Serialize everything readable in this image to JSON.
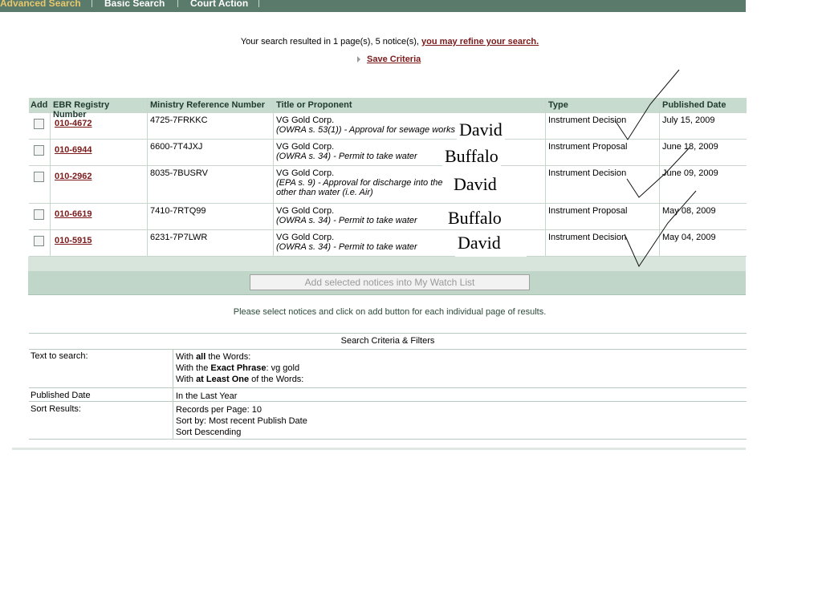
{
  "nav": {
    "items": [
      "Advanced Search",
      "Basic Search",
      "Court Action"
    ]
  },
  "results": {
    "message": "Your search resulted in 1 page(s), 5 notice(s), ",
    "refine_link": "you may refine your search.",
    "save_criteria": "Save Criteria"
  },
  "table": {
    "headers": [
      "Add",
      "EBR Registry Number",
      "Ministry Reference Number",
      "Title or Proponent",
      "Type",
      "Published Date"
    ],
    "rows": [
      {
        "registry": "010-4672",
        "ministry": "4725-7FRKKC",
        "proponent": "VG Gold Corp.",
        "act": "OWRA s. 53(1)",
        "desc": " - Approval for sewage works",
        "desc2": "",
        "type": "Instrument Decision",
        "date": "July 15, 2009",
        "hand": "David"
      },
      {
        "registry": "010-6944",
        "ministry": "6600-7T4JXJ",
        "proponent": "VG Gold Corp.",
        "act": "OWRA s. 34",
        "desc": " - Permit to take water",
        "desc2": "",
        "type": "Instrument Proposal",
        "date": "June 18, 2009",
        "hand": "Buffalo"
      },
      {
        "registry": "010-2962",
        "ministry": "8035-7BUSRV",
        "proponent": "VG Gold Corp.",
        "act": "EPA s. 9",
        "desc": " - Approval for discharge into the",
        "desc2": "other than water (i.e. Air)",
        "type": "Instrument Decision",
        "date": "June 09, 2009",
        "hand": "David"
      },
      {
        "registry": "010-6619",
        "ministry": "7410-7RTQ99",
        "proponent": "VG Gold Corp.",
        "act": "OWRA s. 34",
        "desc": " - Permit to take water",
        "desc2": "",
        "type": "Instrument Proposal",
        "date": "May 08, 2009",
        "hand": "Buffalo"
      },
      {
        "registry": "010-5915",
        "ministry": "6231-7P7LWR",
        "proponent": "VG Gold Corp.",
        "act": "OWRA s. 34",
        "desc": " - Permit to take water",
        "desc2": "",
        "type": "Instrument Decision",
        "date": "May 04, 2009",
        "hand": "David"
      }
    ]
  },
  "watch_button": "Add selected notices into My Watch List",
  "please_text": "Please select notices and click on add button for each individual page of results.",
  "criteria": {
    "title": "Search Criteria & Filters",
    "text_label": "Text to search:",
    "text_lines": [
      {
        "pre": "With ",
        "bold": "all",
        "post": " the Words:"
      },
      {
        "pre": "With the ",
        "bold": "Exact Phrase",
        "post": ": vg gold"
      },
      {
        "pre": "With ",
        "bold": "at Least One",
        "post": " of the Words:"
      }
    ],
    "date_label": "Published Date",
    "date_value": "In the Last Year",
    "sort_label": "Sort Results:",
    "sort_lines": [
      "Records per Page: 10",
      "Sort by: Most recent Publish Date",
      "Sort Descending"
    ]
  }
}
